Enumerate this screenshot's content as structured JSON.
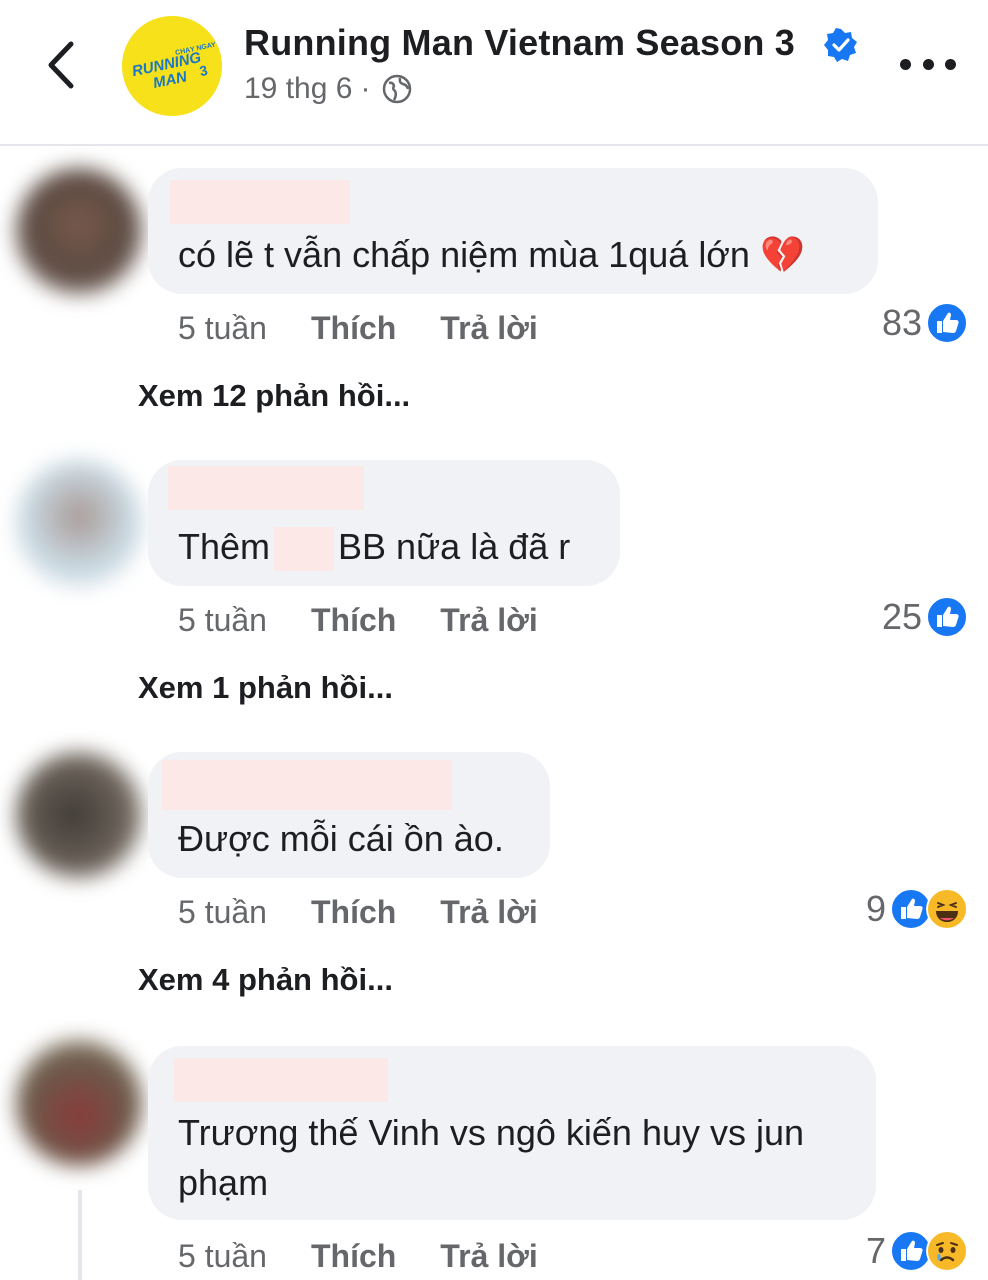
{
  "header": {
    "page_name": "Running Man Vietnam Season 3",
    "post_date": "19 thg 6",
    "separator": "·",
    "logo_text_1": "RUNNING",
    "logo_text_2": "MAN",
    "logo_text_3": "CHẠY NGAY ĐI",
    "icons": [
      "back-chevron-icon",
      "verified-badge-icon",
      "globe-icon",
      "more-options-icon"
    ]
  },
  "comments": [
    {
      "text": "có lẽ t vẫn chấp niệm mùa 1quá lớn 💔",
      "time": "5 tuần",
      "like_label": "Thích",
      "reply_label": "Trả lời",
      "reaction_count": "83",
      "reactions": [
        "like"
      ],
      "view_replies": "Xem 12 phản hồi..."
    },
    {
      "text_before": "Thêm",
      "text_after": "BB nữa là đã r",
      "time": "5 tuần",
      "like_label": "Thích",
      "reply_label": "Trả lời",
      "reaction_count": "25",
      "reactions": [
        "like"
      ],
      "view_replies": "Xem 1 phản hồi..."
    },
    {
      "text": "Được mỗi cái ồn ào.",
      "time": "5 tuần",
      "like_label": "Thích",
      "reply_label": "Trả lời",
      "reaction_count": "9",
      "reactions": [
        "like",
        "haha"
      ],
      "view_replies": "Xem 4 phản hồi..."
    },
    {
      "text_line1": "Trương thế Vinh vs ngô kiến huy vs jun",
      "text_line2": "phạm",
      "time": "5 tuần",
      "like_label": "Thích",
      "reply_label": "Trả lời",
      "reaction_count": "7",
      "reactions": [
        "like",
        "sad"
      ]
    }
  ],
  "colors": {
    "like_blue": "#1877f2",
    "bubble_bg": "#f0f2f5",
    "muted_text": "#65676b",
    "redaction": "#fde8e8",
    "logo_yellow": "#f7e11a"
  }
}
